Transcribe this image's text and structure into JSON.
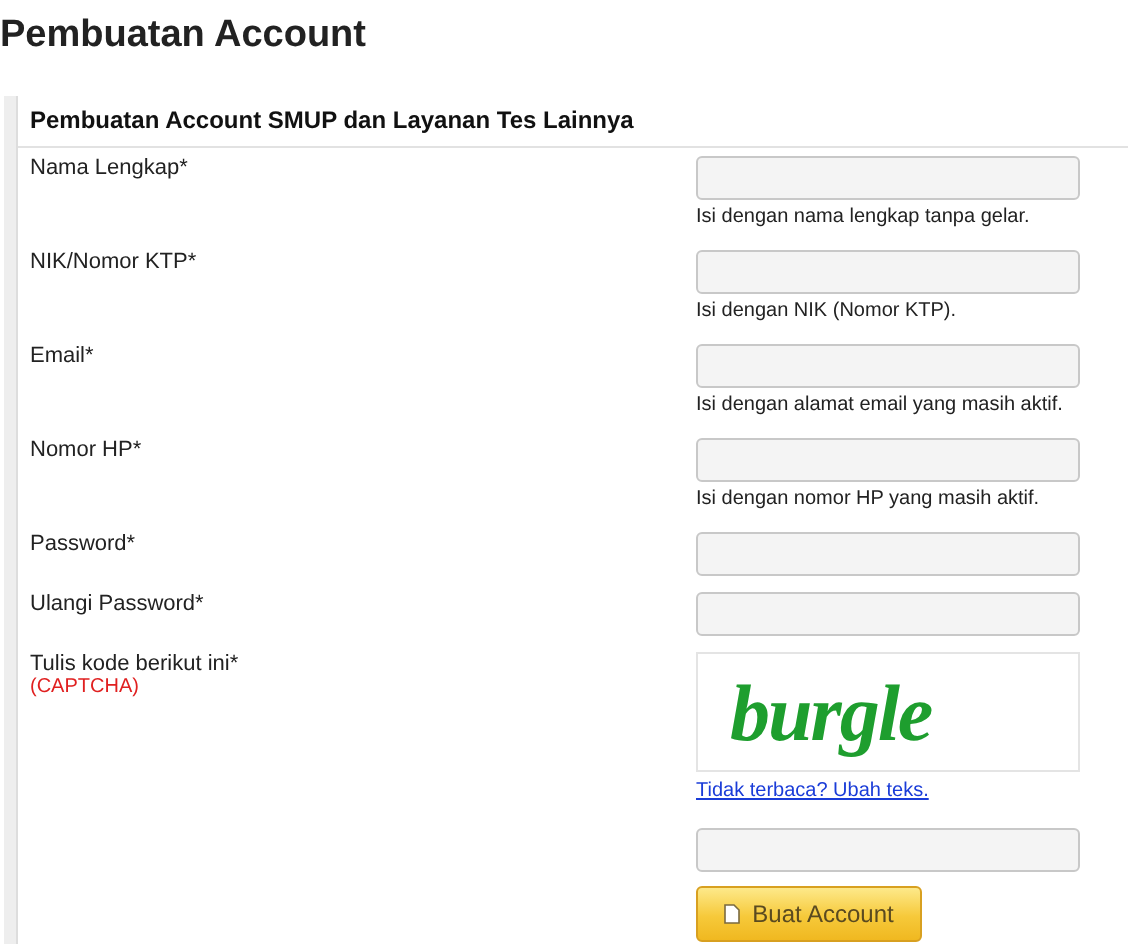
{
  "page_title": "Pembuatan Account",
  "panel": {
    "heading": "Pembuatan Account SMUP dan Layanan Tes Lainnya",
    "fields": [
      {
        "kind": "text",
        "label": "Nama Lengkap*",
        "hint": "Isi dengan nama lengkap tanpa gelar."
      },
      {
        "kind": "text",
        "label": "NIK/Nomor KTP*",
        "hint": "Isi dengan NIK (Nomor KTP)."
      },
      {
        "kind": "text",
        "label": "Email*",
        "hint": "Isi dengan alamat email yang masih aktif."
      },
      {
        "kind": "text",
        "label": "Nomor HP*",
        "hint": "Isi dengan nomor HP yang masih aktif."
      },
      {
        "kind": "password",
        "label": "Password*"
      },
      {
        "kind": "password",
        "label": "Ulangi Password*"
      },
      {
        "kind": "captcha",
        "label": "Tulis kode berikut ini*",
        "note": "(CAPTCHA)",
        "captcha_text": "burgle",
        "link": "Tidak terbaca? Ubah teks."
      }
    ],
    "submit": "Buat Account"
  }
}
